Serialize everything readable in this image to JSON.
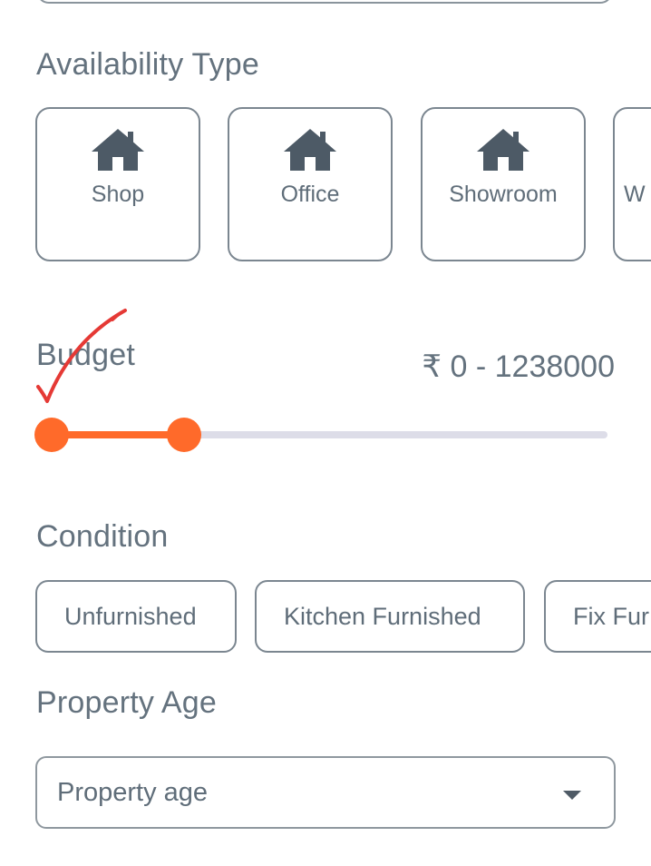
{
  "availability": {
    "title": "Availability Type",
    "options": [
      {
        "label": "Shop",
        "icon": "house-icon"
      },
      {
        "label": "Office",
        "icon": "house-icon"
      },
      {
        "label": "Showroom",
        "icon": "house-icon"
      },
      {
        "label": "W",
        "icon": "house-icon"
      }
    ]
  },
  "budget": {
    "title": "Budget",
    "amount": "₹ 0 - 1238000",
    "range_fraction": [
      0,
      0.24
    ]
  },
  "condition": {
    "title": "Condition",
    "options": [
      "Unfurnished",
      "Kitchen Furnished",
      "Fix Fur"
    ]
  },
  "property_age": {
    "title": "Property Age",
    "placeholder": "Property age"
  },
  "colors": {
    "accent": "#ff6a2a",
    "text": "#64727e",
    "border": "#7b8690",
    "track": "#dddde8",
    "annotation": "#e53935"
  }
}
